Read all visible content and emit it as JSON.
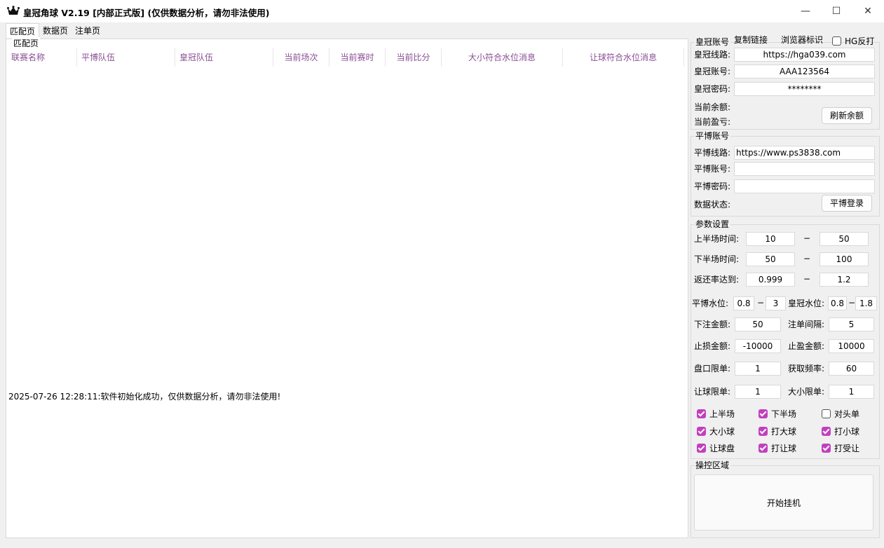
{
  "window": {
    "title": "皇冠角球 V2.19 [内部正式版]   (仅供数据分析，请勿非法使用)",
    "icon": "crown-icon",
    "minimize_glyph": "—",
    "maximize_glyph": "☐",
    "close_glyph": "✕"
  },
  "tabs": [
    {
      "label": "匹配页"
    },
    {
      "label": "数据页"
    },
    {
      "label": "注单页"
    }
  ],
  "main": {
    "group_label": "匹配页",
    "columns": [
      "联赛名称",
      "平博队伍",
      "皇冠队伍",
      "当前场次",
      "当前赛时",
      "当前比分",
      "大小符合水位消息",
      "让球符合水位消息"
    ],
    "header_color": "#8a4e95",
    "log_message": "2025-07-26 12:28:11:软件初始化成功，仅供数据分析，请勿非法使用!"
  },
  "crown": {
    "legend": "皇冠账号",
    "copy_link": "复制链接",
    "browser_mark": "浏览器标识",
    "hg_reverse_label": "HG反打",
    "hg_reverse_checked": false,
    "line_label": "皇冠线路:",
    "line_value": "https://hga039.com",
    "account_label": "皇冠账号:",
    "account_value": "AAA123564",
    "password_label": "皇冠密码:",
    "password_value": "********",
    "balance_label": "当前余额:",
    "profit_label": "当前盈亏:",
    "refresh_button": "刷新余额"
  },
  "pinnacle": {
    "legend": "平博账号",
    "line_label": "平博线路:",
    "line_value": "https://www.ps3838.com",
    "account_label": "平博账号:",
    "account_value": "",
    "password_label": "平博密码:",
    "password_value": "",
    "status_label": "数据状态:",
    "login_button": "平博登录"
  },
  "params": {
    "legend": "参数设置",
    "first_half_label": "上半场时间:",
    "first_half_min": "10",
    "first_half_max": "50",
    "second_half_label": "下半场时间:",
    "second_half_min": "50",
    "second_half_max": "100",
    "rebate_label": "返还率达到:",
    "rebate_min": "0.999",
    "rebate_max": "1.2",
    "dash": "−",
    "pb_odds_label": "平博水位:",
    "pb_odds_min": "0.8",
    "pb_odds_max": "3",
    "hg_odds_label": "皇冠水位:",
    "hg_odds_min": "0.8",
    "hg_odds_max": "1.8",
    "stake_label": "下注金额:",
    "stake_value": "50",
    "interval_label": "注单间隔:",
    "interval_value": "5",
    "stop_loss_label": "止损金额:",
    "stop_loss_value": "-10000",
    "take_profit_label": "止盈金额:",
    "take_profit_value": "10000",
    "market_limit_label": "盘口限单:",
    "market_limit_value": "1",
    "fetch_rate_label": "获取频率:",
    "fetch_rate_value": "60",
    "handicap_limit_label": "让球限单:",
    "handicap_limit_value": "1",
    "ou_limit_label": "大小限单:",
    "ou_limit_value": "1",
    "checkboxes": [
      {
        "label": "上半场",
        "checked": true
      },
      {
        "label": "下半场",
        "checked": true
      },
      {
        "label": "对头单",
        "checked": false
      },
      {
        "label": "大小球",
        "checked": true
      },
      {
        "label": "打大球",
        "checked": true
      },
      {
        "label": "打小球",
        "checked": true
      },
      {
        "label": "让球盘",
        "checked": true
      },
      {
        "label": "打让球",
        "checked": true
      },
      {
        "label": "打受让",
        "checked": true
      }
    ],
    "checkbox_color": "#c23fbf"
  },
  "control": {
    "legend": "操控区域",
    "start_button": "开始挂机"
  }
}
